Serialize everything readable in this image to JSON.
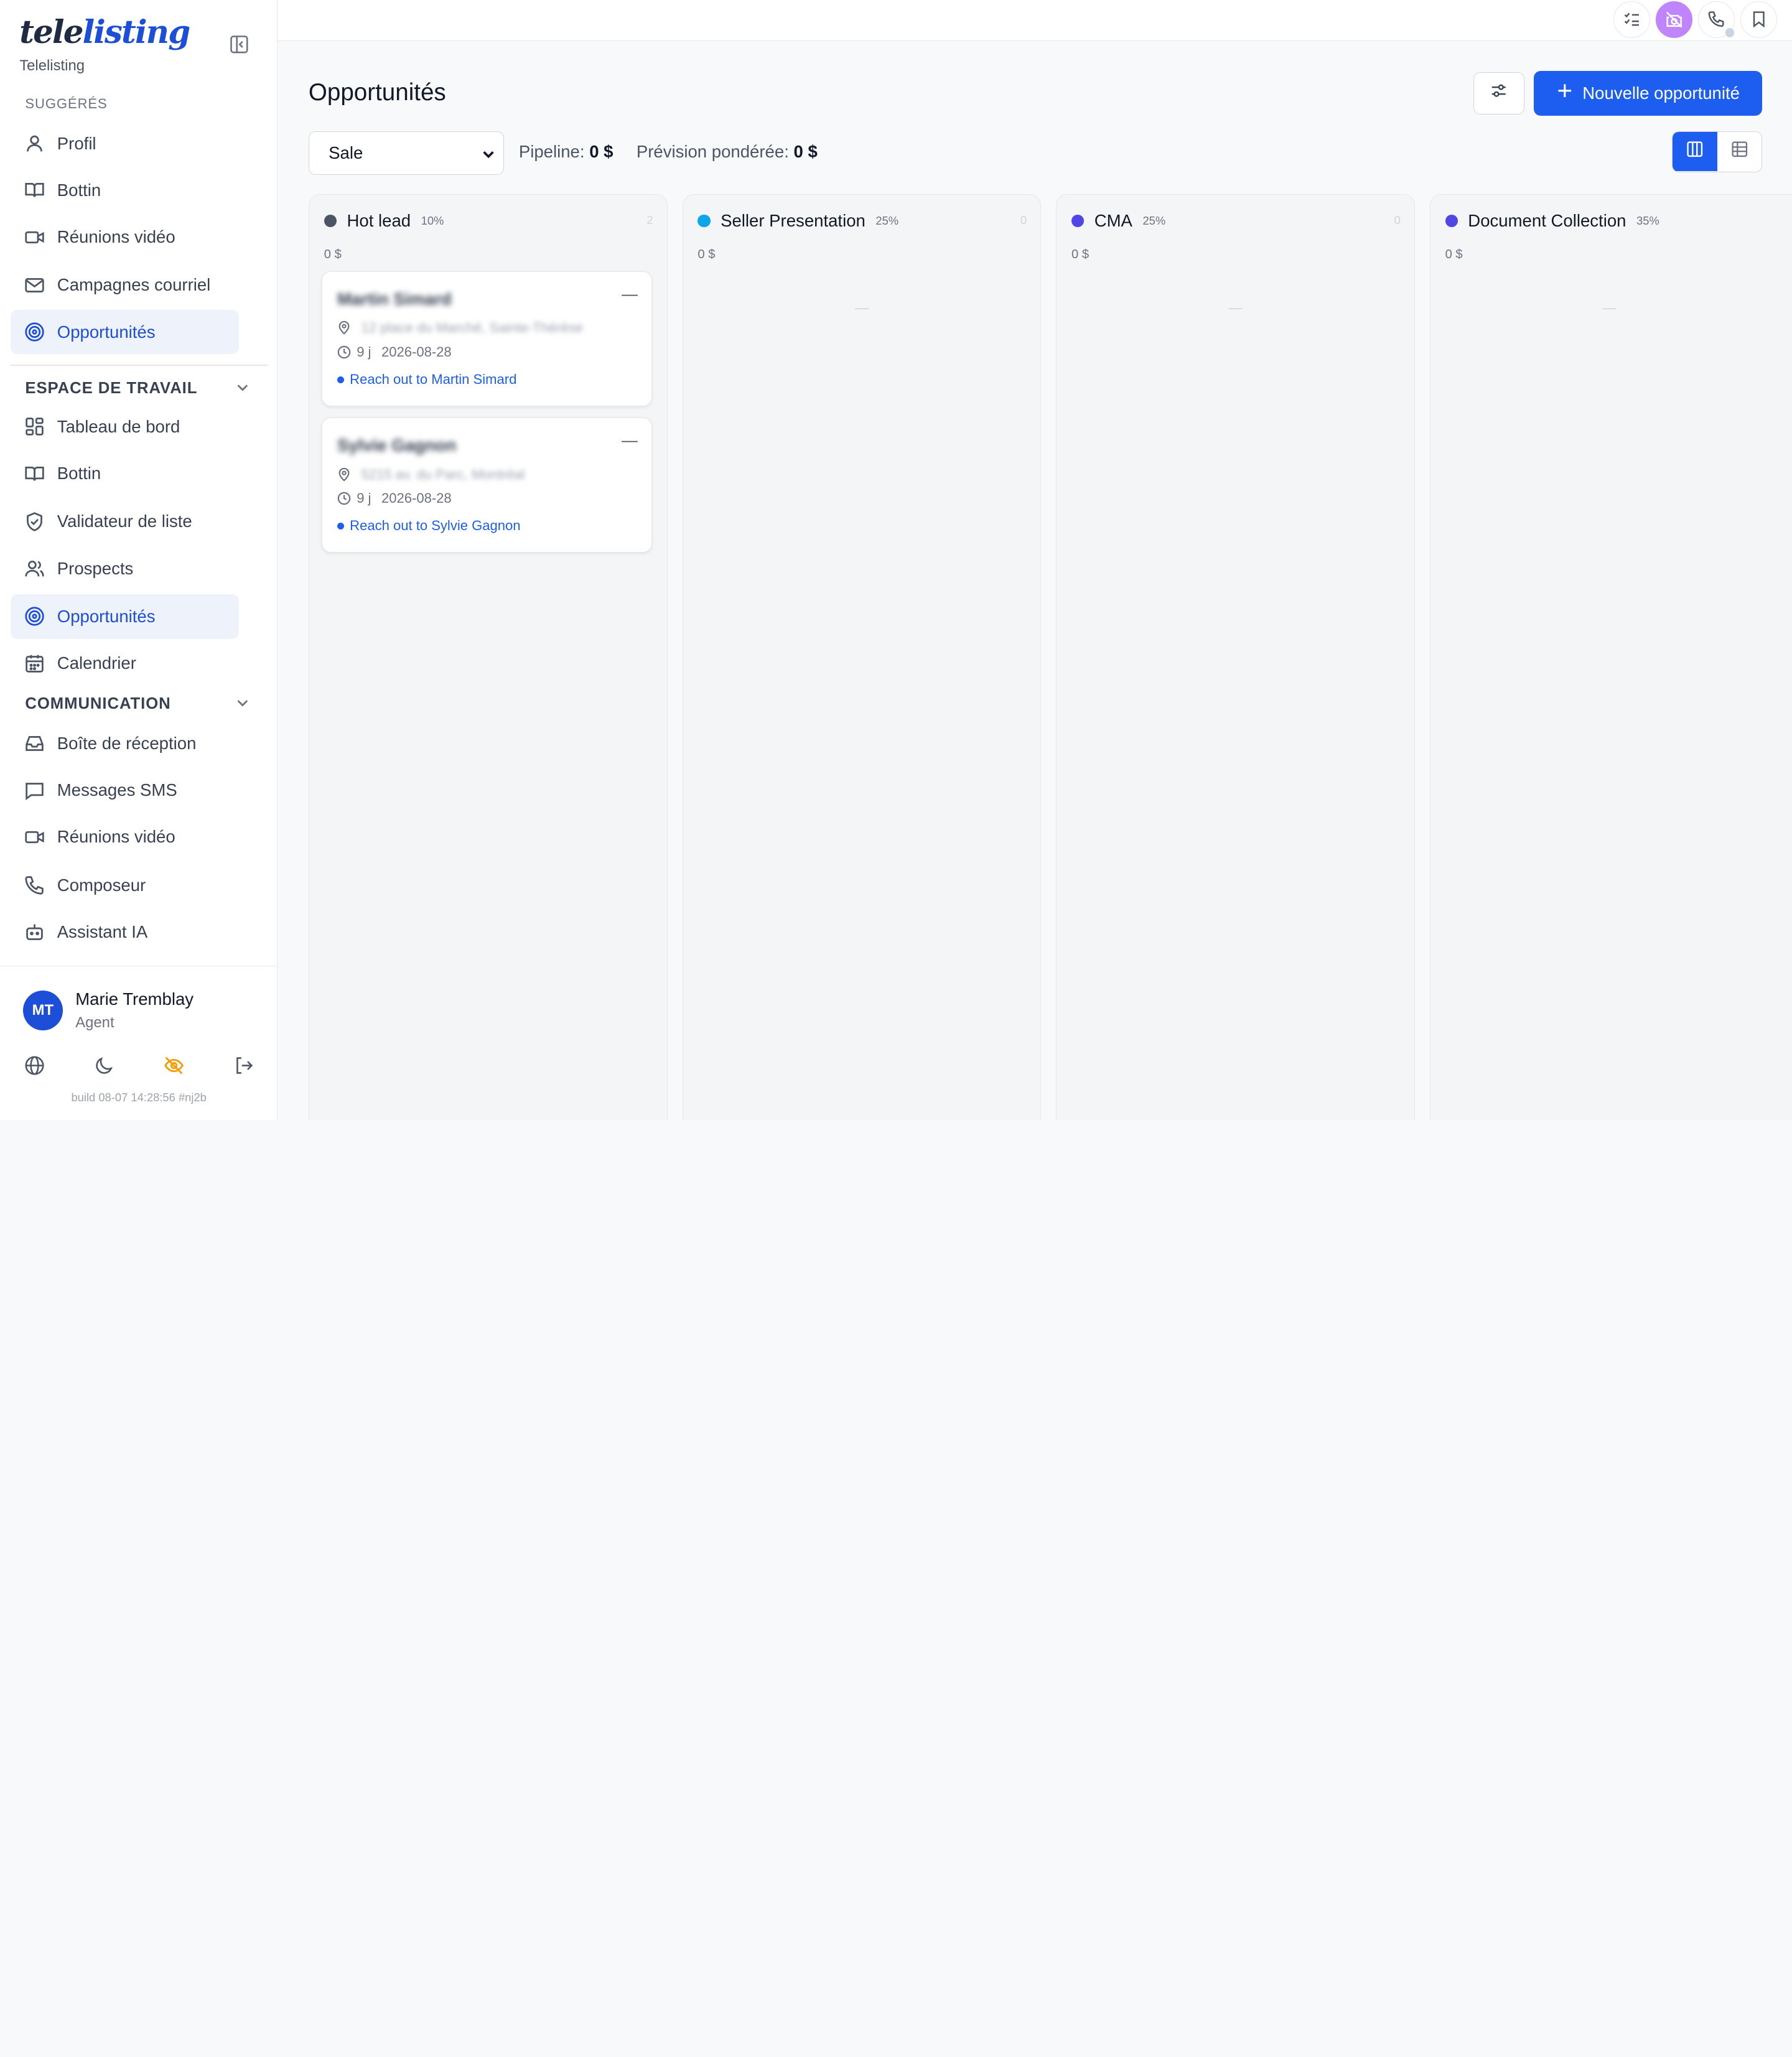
{
  "brand": {
    "logo_part1": "tele",
    "logo_part2": "listing",
    "name": "Telelisting"
  },
  "sidebar": {
    "suggested_label": "SUGGÉRÉS",
    "suggested": [
      {
        "label": "Profil",
        "icon": "user-icon"
      },
      {
        "label": "Bottin",
        "icon": "book-icon"
      },
      {
        "label": "Réunions vidéo",
        "icon": "video-icon"
      },
      {
        "label": "Campagnes courriel",
        "icon": "mail-icon"
      },
      {
        "label": "Opportunités",
        "icon": "target-icon",
        "active": true
      }
    ],
    "workspace_label": "ESPACE DE TRAVAIL",
    "workspace": [
      {
        "label": "Tableau de bord",
        "icon": "dashboard-icon"
      },
      {
        "label": "Bottin",
        "icon": "book-icon"
      },
      {
        "label": "Validateur de liste",
        "icon": "shield-check-icon"
      },
      {
        "label": "Prospects",
        "icon": "users-icon"
      },
      {
        "label": "Opportunités",
        "icon": "target-icon",
        "active": true
      },
      {
        "label": "Calendrier",
        "icon": "calendar-icon"
      }
    ],
    "communication_label": "COMMUNICATION",
    "communication": [
      {
        "label": "Boîte de réception",
        "icon": "inbox-icon"
      },
      {
        "label": "Messages SMS",
        "icon": "message-icon"
      },
      {
        "label": "Réunions vidéo",
        "icon": "video-icon"
      },
      {
        "label": "Composeur",
        "icon": "phone-icon"
      },
      {
        "label": "Assistant IA",
        "icon": "bot-icon"
      }
    ],
    "user": {
      "initials": "MT",
      "name": "Marie Tremblay",
      "role": "Agent"
    },
    "build": "build 08-07 14:28:56 #nj2b"
  },
  "main": {
    "title": "Opportunités",
    "new_button_label": "Nouvelle opportunité",
    "pipeline_value": "Sale",
    "pipeline_label": "Pipeline:",
    "pipeline_amount": "0 $",
    "forecast_label": "Prévision pondérée:",
    "forecast_amount": "0 $"
  },
  "columns": [
    {
      "name": "Hot lead",
      "percent": "10%",
      "count": "2",
      "total": "0 $",
      "color": "#4b5563",
      "cards": [
        {
          "name": "Martin Simard",
          "address": "12 place du Marché, Sainte-Thérèse",
          "days": "9 j",
          "date": "2026-08-28",
          "task": "Reach out to Martin Simard"
        },
        {
          "name": "Sylvie Gagnon",
          "address": "5215 av. du Parc, Montréal",
          "days": "9 j",
          "date": "2026-08-28",
          "task": "Reach out to Sylvie Gagnon"
        }
      ]
    },
    {
      "name": "Seller Presentation",
      "percent": "25%",
      "count": "0",
      "total": "0 $",
      "color": "#0ea5e9",
      "empty": "—",
      "cards": []
    },
    {
      "name": "CMA",
      "percent": "25%",
      "count": "0",
      "total": "0 $",
      "color": "#4f46e5",
      "empty": "—",
      "cards": []
    },
    {
      "name": "Document Collection",
      "percent": "35%",
      "count": "0",
      "total": "0 $",
      "color": "#4f46e5",
      "empty": "—",
      "cards": []
    }
  ]
}
